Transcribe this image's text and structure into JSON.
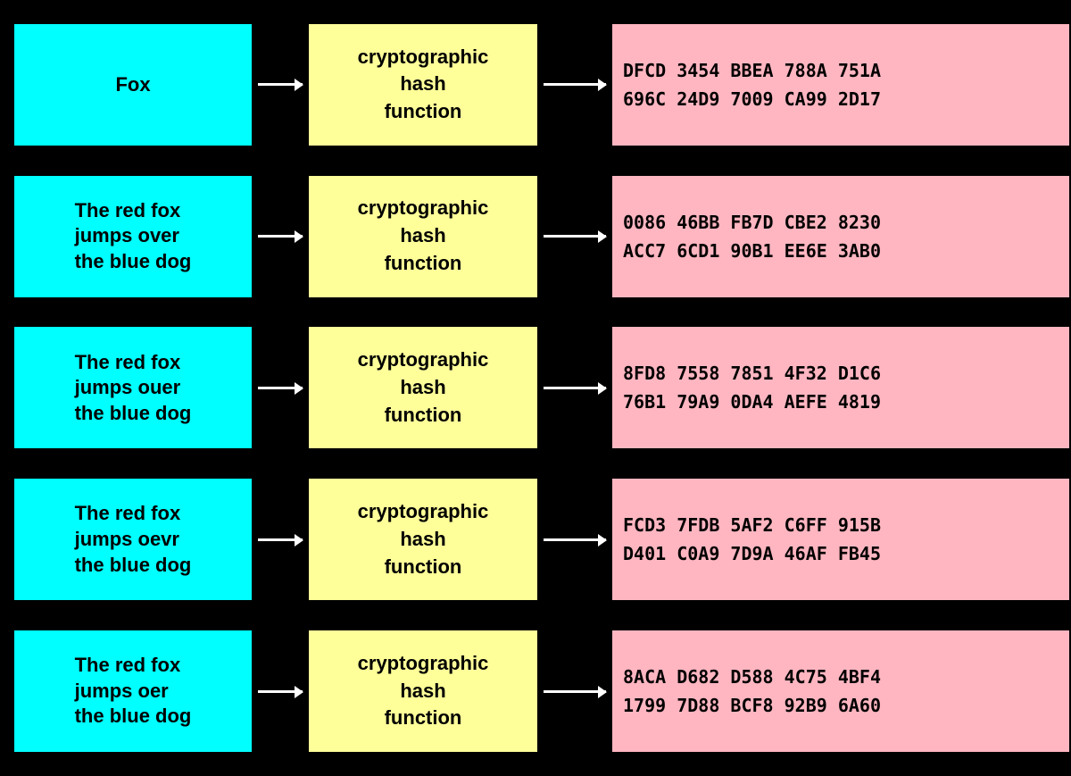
{
  "rows": [
    {
      "id": "row-1",
      "input": "Fox",
      "hash_label": "cryptographic\nhash\nfunction",
      "output_line1": "DFCD  3454  BBEA  788A  751A",
      "output_line2": "696C  24D9  7009  CA99  2D17"
    },
    {
      "id": "row-2",
      "input": "The red fox\njumps over\nthe blue dog",
      "hash_label": "cryptographic\nhash\nfunction",
      "output_line1": "0086  46BB  FB7D  CBE2  8230",
      "output_line2": "ACC7  6CD1  90B1  EE6E  3AB0"
    },
    {
      "id": "row-3",
      "input": "The red fox\njumps ouer\nthe blue dog",
      "hash_label": "cryptographic\nhash\nfunction",
      "output_line1": "8FD8  7558  7851  4F32  D1C6",
      "output_line2": "76B1  79A9  0DA4  AEFE  4819"
    },
    {
      "id": "row-4",
      "input": "The red fox\njumps oevr\nthe blue dog",
      "hash_label": "cryptographic\nhash\nfunction",
      "output_line1": "FCD3  7FDB  5AF2  C6FF  915B",
      "output_line2": "D401  C0A9  7D9A  46AF  FB45"
    },
    {
      "id": "row-5",
      "input": "The red fox\njumps oer\nthe blue dog",
      "hash_label": "cryptographic\nhash\nfunction",
      "output_line1": "8ACA  D682  D588  4C75  4BF4",
      "output_line2": "1799  7D88  BCF8  92B9  6A60"
    }
  ]
}
